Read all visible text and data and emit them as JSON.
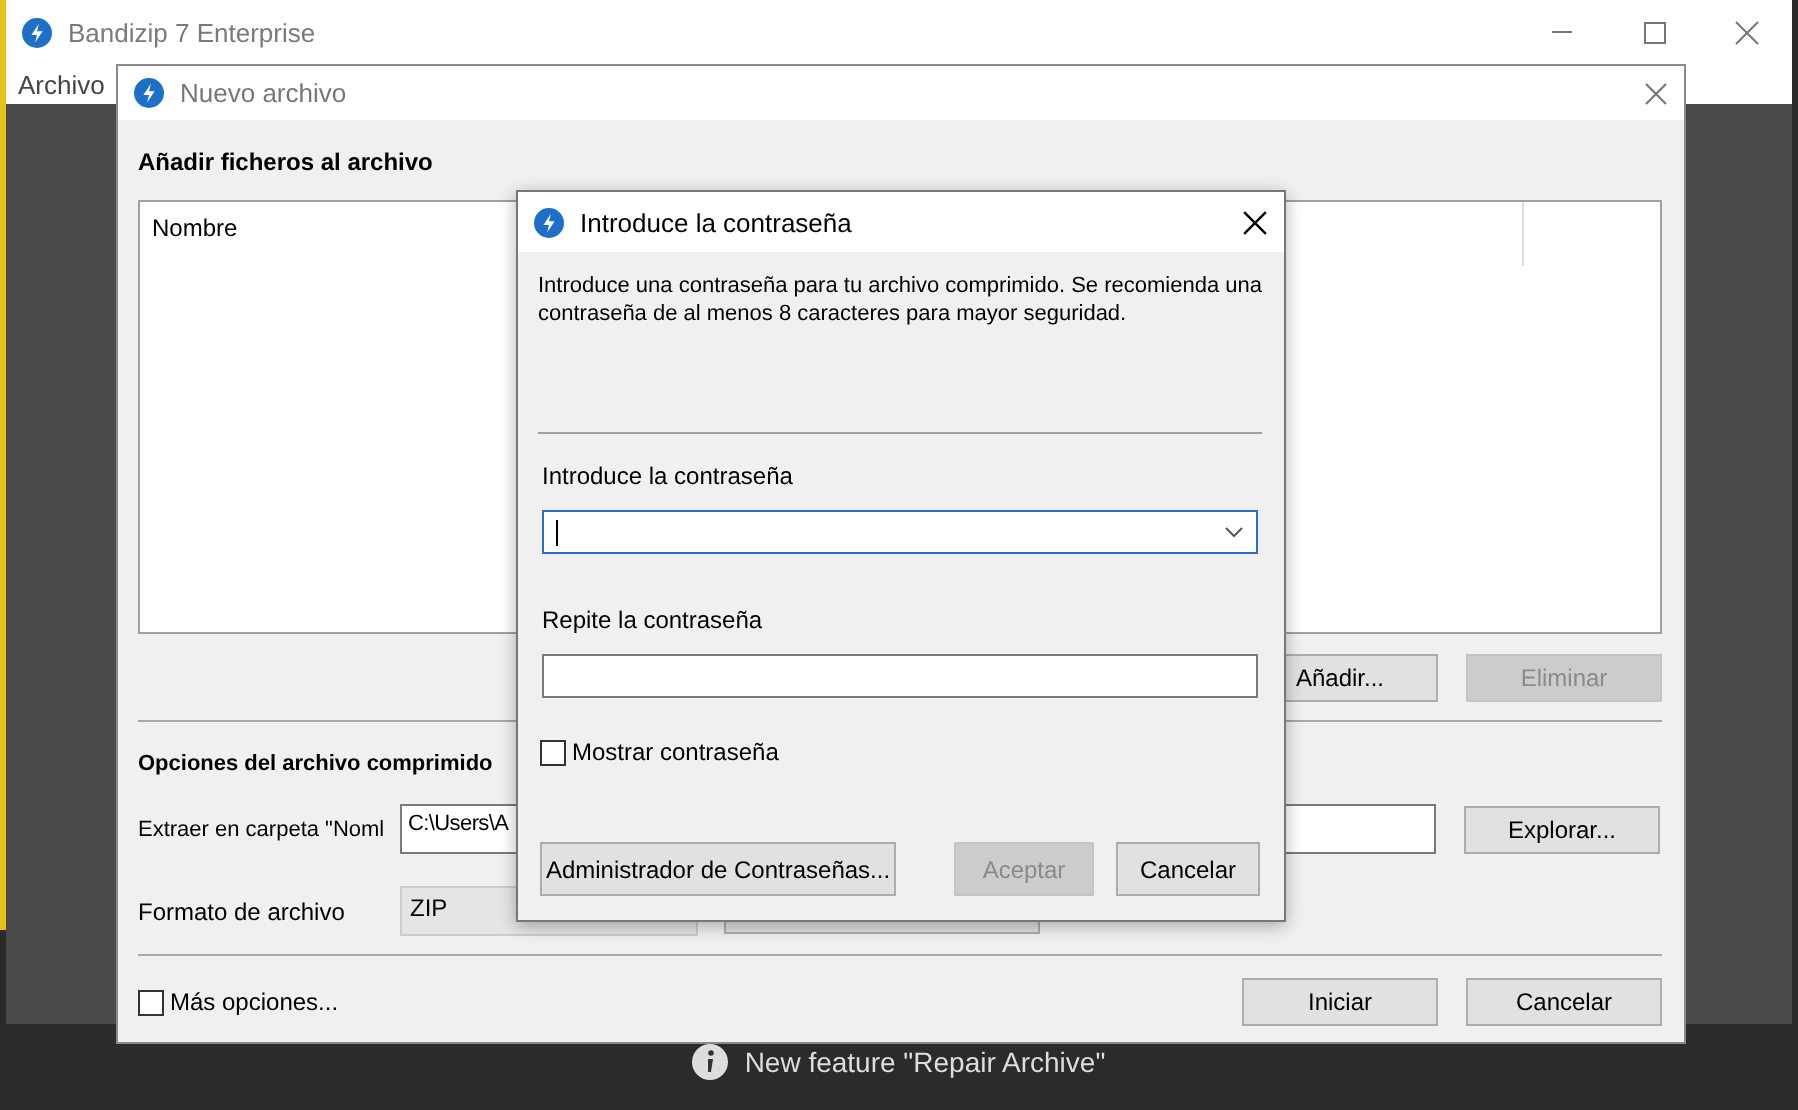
{
  "main_window": {
    "title": "Bandizip 7 Enterprise",
    "menu": [
      "Archivo"
    ],
    "status_bar": {
      "text": "New feature \"Repair Archive\""
    }
  },
  "new_archive_dialog": {
    "title": "Nuevo archivo",
    "files_section": {
      "heading": "Añadir ficheros al archivo",
      "columns": [
        "Nombre"
      ],
      "buttons": [
        {
          "label": "Añadir...",
          "disabled": false
        },
        {
          "label": "Eliminar",
          "disabled": true
        }
      ]
    },
    "options_section": {
      "heading": "Opciones del archivo comprimido",
      "fields": [
        {
          "label": "Extraer en carpeta \"Noml",
          "value": "C:\\Users\\A",
          "disabled": false,
          "button": "Explorar..."
        },
        {
          "label": "Formato de archivo",
          "value": "ZIP",
          "disabled": true
        }
      ]
    },
    "more_options": {
      "label": "Más opciones...",
      "checked": false
    },
    "buttons": [
      {
        "label": "Iniciar",
        "disabled": false
      },
      {
        "label": "Cancelar",
        "disabled": false
      }
    ]
  },
  "password_dialog": {
    "title": "Introduce la contraseña",
    "description": "Introduce una contraseña para tu archivo comprimido. Se recomienda una contraseña de al menos 8 caracteres para mayor seguridad.",
    "fields": [
      {
        "label": "Introduce la contraseña",
        "kind": "combo",
        "focused": true
      },
      {
        "label": "Repite la contraseña",
        "kind": "text",
        "focused": false
      }
    ],
    "show_password": {
      "label": "Mostrar contraseña",
      "checked": false
    },
    "buttons": [
      {
        "label": "Administrador de Contraseñas...",
        "disabled": false
      },
      {
        "label": "Aceptar",
        "disabled": true
      },
      {
        "label": "Cancelar",
        "disabled": false
      }
    ]
  }
}
